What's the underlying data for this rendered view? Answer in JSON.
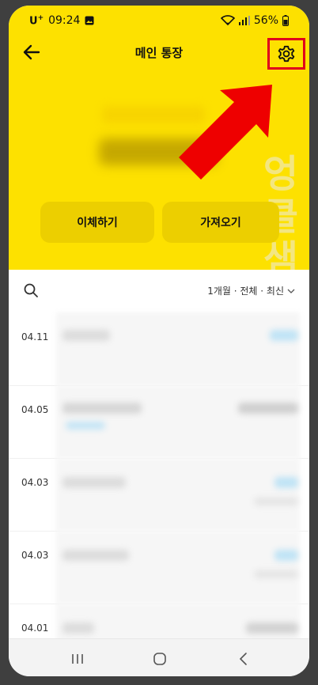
{
  "status": {
    "carrier": "U",
    "carrier_sup": "+",
    "time": "09:24",
    "battery": "56%"
  },
  "header": {
    "title": "메인 통장"
  },
  "actions": {
    "transfer": "이체하기",
    "import": "가져오기"
  },
  "watermark": "엉클샘이",
  "filter": {
    "label": "1개월 · 전체 · 최신"
  },
  "transactions": [
    {
      "date": "04.11"
    },
    {
      "date": "04.05"
    },
    {
      "date": "04.03"
    },
    {
      "date": "04.03"
    },
    {
      "date": "04.01"
    }
  ],
  "colors": {
    "accent": "#fde100",
    "highlight_box": "#e0001c",
    "arrow": "#ee0000"
  },
  "icons": [
    "arrow-left-icon",
    "gear-icon",
    "search-icon",
    "chevron-down-icon",
    "recent-apps-icon",
    "home-icon",
    "back-nav-icon"
  ]
}
